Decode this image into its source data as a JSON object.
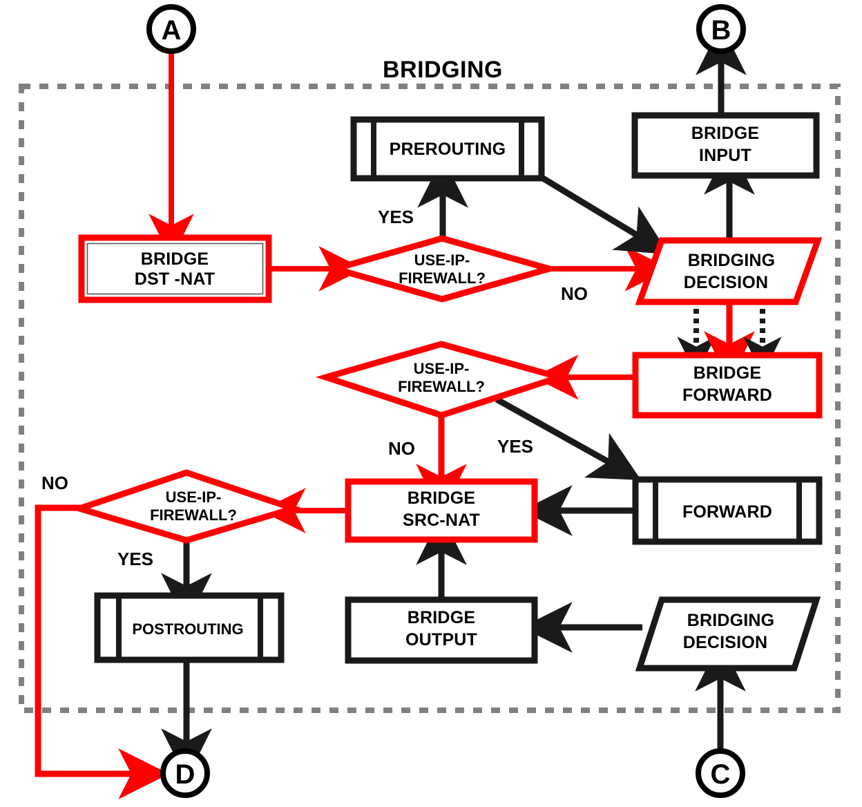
{
  "diagram": {
    "title": "BRIDGING",
    "group_border_style": "dashed",
    "colors": {
      "red": "#FF0000",
      "black": "#1A1A1A",
      "dashed_border": "#808080",
      "background": "#FFFFFF"
    }
  },
  "connectors": [
    {
      "id": "A",
      "label": "A"
    },
    {
      "id": "B",
      "label": "B"
    },
    {
      "id": "C",
      "label": "C"
    },
    {
      "id": "D",
      "label": "D"
    }
  ],
  "nodes": {
    "bridge_dst_nat": {
      "line1": "BRIDGE",
      "line2": "DST -NAT",
      "shape": "process",
      "color": "red"
    },
    "prerouting": {
      "line1": "PREROUTING",
      "line2": "",
      "shape": "subprocess",
      "color": "black"
    },
    "use_ip_fw_1": {
      "line1": "USE-IP-",
      "line2": "FIREWALL?",
      "shape": "decision",
      "color": "red"
    },
    "bridge_input": {
      "line1": "BRIDGE",
      "line2": "INPUT",
      "shape": "process",
      "color": "black"
    },
    "bridging_dec_top": {
      "line1": "BRIDGING",
      "line2": "DECISION",
      "shape": "parallelogram",
      "color": "red"
    },
    "bridge_forward": {
      "line1": "BRIDGE",
      "line2": "FORWARD",
      "shape": "process",
      "color": "red"
    },
    "use_ip_fw_2": {
      "line1": "USE-IP-",
      "line2": "FIREWALL?",
      "shape": "decision",
      "color": "red"
    },
    "forward": {
      "line1": "FORWARD",
      "line2": "",
      "shape": "subprocess",
      "color": "black"
    },
    "bridge_src_nat": {
      "line1": "BRIDGE",
      "line2": "SRC-NAT",
      "shape": "process",
      "color": "red"
    },
    "use_ip_fw_3": {
      "line1": "USE-IP-",
      "line2": "FIREWALL?",
      "shape": "decision",
      "color": "red"
    },
    "postrouting": {
      "line1": "POSTROUTING",
      "line2": "",
      "shape": "subprocess",
      "color": "black"
    },
    "bridge_output": {
      "line1": "BRIDGE",
      "line2": "OUTPUT",
      "shape": "process",
      "color": "black"
    },
    "bridging_dec_bot": {
      "line1": "BRIDGING",
      "line2": "DECISION",
      "shape": "parallelogram",
      "color": "black"
    }
  },
  "edge_labels": {
    "yes_prerouting": "YES",
    "no_to_decision": "NO",
    "no_to_srcnat": "NO",
    "yes_to_forward": "YES",
    "no_left_loop": "NO",
    "yes_postrouting": "YES"
  }
}
